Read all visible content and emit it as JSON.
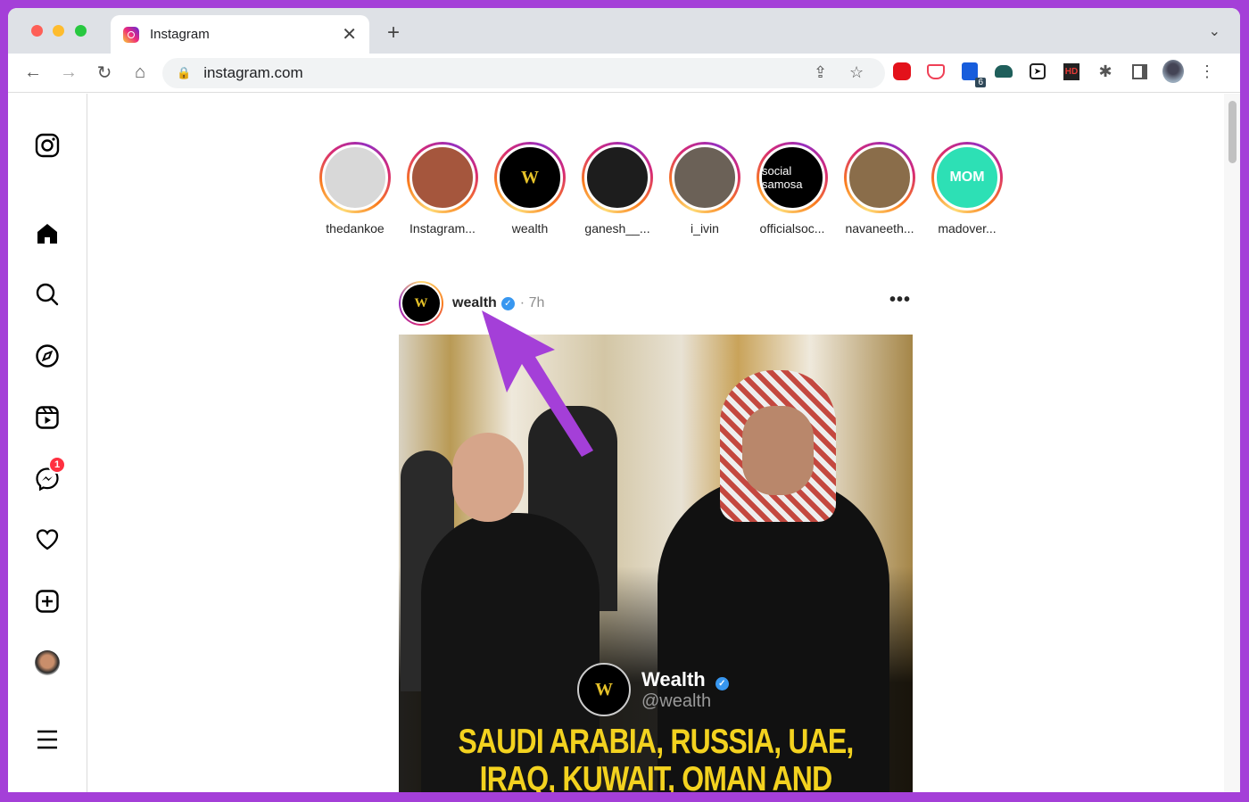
{
  "browser": {
    "tab_title": "Instagram",
    "url": "instagram.com",
    "extension_badge": "6",
    "ext_hd_label": "HD"
  },
  "sidebar": {
    "notification_count": "1",
    "items": [
      "instagram-logo",
      "home",
      "search",
      "explore",
      "reels",
      "messages",
      "notifications",
      "create",
      "profile",
      "more"
    ]
  },
  "stories": [
    {
      "name": "thedankoe",
      "bg": "#d8d8d8"
    },
    {
      "name": "Instagram...",
      "bg": "#a5563d"
    },
    {
      "name": "wealth",
      "bg": "#000000",
      "logo": "W"
    },
    {
      "name": "ganesh__...",
      "bg": "#1d1d1d"
    },
    {
      "name": "i_ivin",
      "bg": "#6b6157"
    },
    {
      "name": "officialsoc...",
      "bg": "#000000",
      "logo": "social samosa"
    },
    {
      "name": "navaneeth...",
      "bg": "#8a6d4a"
    },
    {
      "name": "madover...",
      "bg": "#2de0b5",
      "logo": "MOM"
    }
  ],
  "post": {
    "username": "wealth",
    "verified": true,
    "time": "7h",
    "avatar_logo": "W",
    "overlay_name": "Wealth",
    "overlay_handle": "@wealth",
    "headline_line1": "SAUDI ARABIA, RUSSIA, UAE,",
    "headline_line2": "IRAQ, KUWAIT, OMAN AND ALGERIA"
  },
  "colors": {
    "annotation_arrow": "#a43fd8",
    "border": "#a43fd8",
    "verified": "#3897f0",
    "notification": "#ff3040",
    "headline": "#f3d21f"
  }
}
